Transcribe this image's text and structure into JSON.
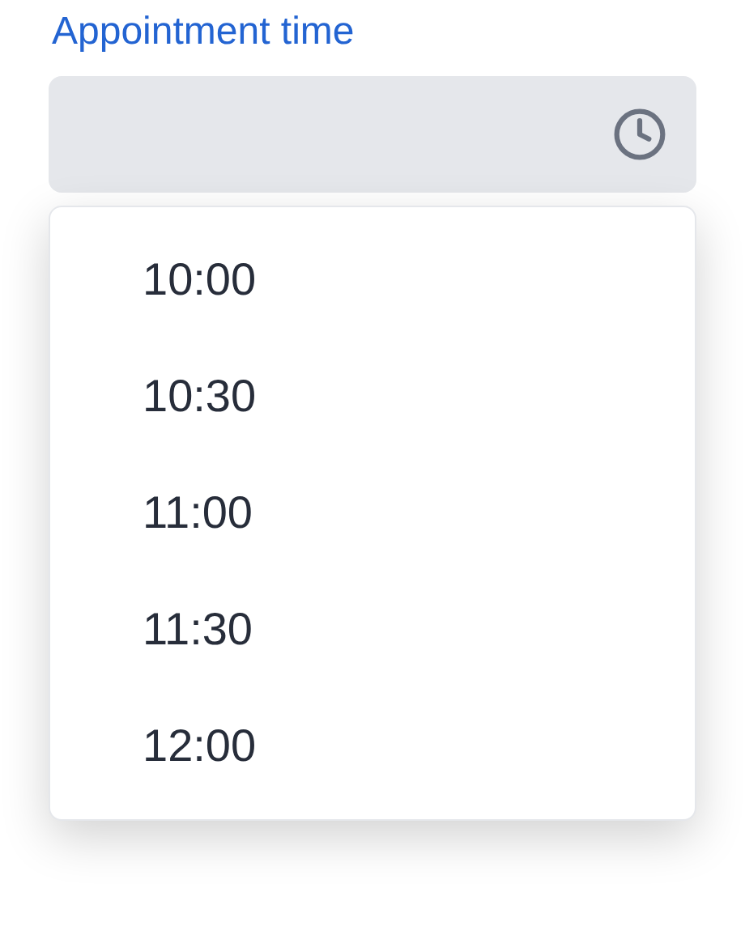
{
  "field": {
    "label": "Appointment time"
  },
  "options": [
    {
      "label": "10:00"
    },
    {
      "label": "10:30"
    },
    {
      "label": "11:00"
    },
    {
      "label": "11:30"
    },
    {
      "label": "12:00"
    }
  ]
}
